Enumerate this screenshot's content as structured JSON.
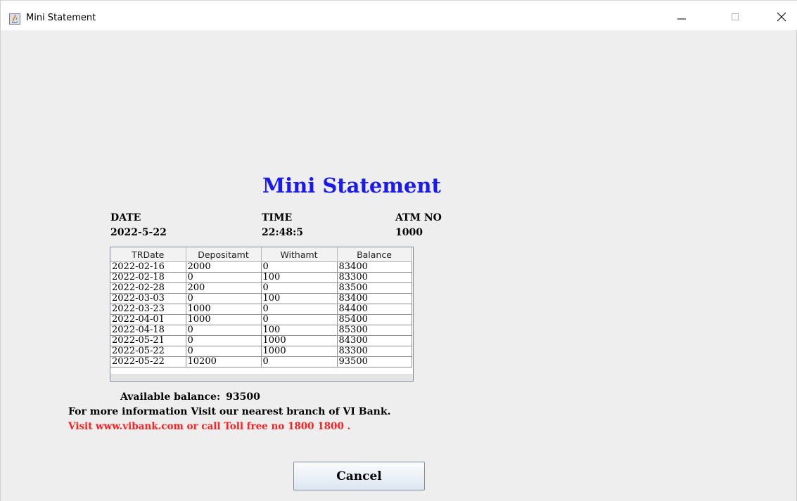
{
  "window": {
    "title": "Mini Statement",
    "controls": {
      "minimize_icon": "minimize-icon",
      "maximize_icon": "maximize-icon",
      "close_icon": "close-icon"
    }
  },
  "heading": "Mini Statement",
  "info": {
    "date_label": "DATE",
    "date_value": "2022-5-22",
    "time_label": "TIME",
    "time_value": "22:48:5",
    "atm_label": "ATM NO",
    "atm_value": "1000"
  },
  "table": {
    "columns": [
      "TRDate",
      "Depositamt",
      "Withamt",
      "Balance"
    ],
    "rows": [
      [
        "2022-02-16",
        "2000",
        "0",
        "83400"
      ],
      [
        "2022-02-18",
        "0",
        "100",
        "83300"
      ],
      [
        "2022-02-28",
        "200",
        "0",
        "83500"
      ],
      [
        "2022-03-03",
        "0",
        "100",
        "83400"
      ],
      [
        "2022-03-23",
        "1000",
        "0",
        "84400"
      ],
      [
        "2022-04-01",
        "1000",
        "0",
        "85400"
      ],
      [
        "2022-04-18",
        "0",
        "100",
        "85300"
      ],
      [
        "2022-05-21",
        "0",
        "1000",
        "84300"
      ],
      [
        "2022-05-22",
        "0",
        "1000",
        "83300"
      ],
      [
        "2022-05-22",
        "10200",
        "0",
        "93500"
      ]
    ]
  },
  "balance": {
    "label": "Available balance:",
    "amount": "93500"
  },
  "info_line": "For more information Visit our nearest branch of VI Bank.",
  "contact_line": "Visit www.vibank.com or call Toll free no 1800 1800 .",
  "cancel_label": "Cancel",
  "colors": {
    "heading": "#1a1aef",
    "contact": "#ff2020",
    "window_bg": "#eeeeee"
  }
}
